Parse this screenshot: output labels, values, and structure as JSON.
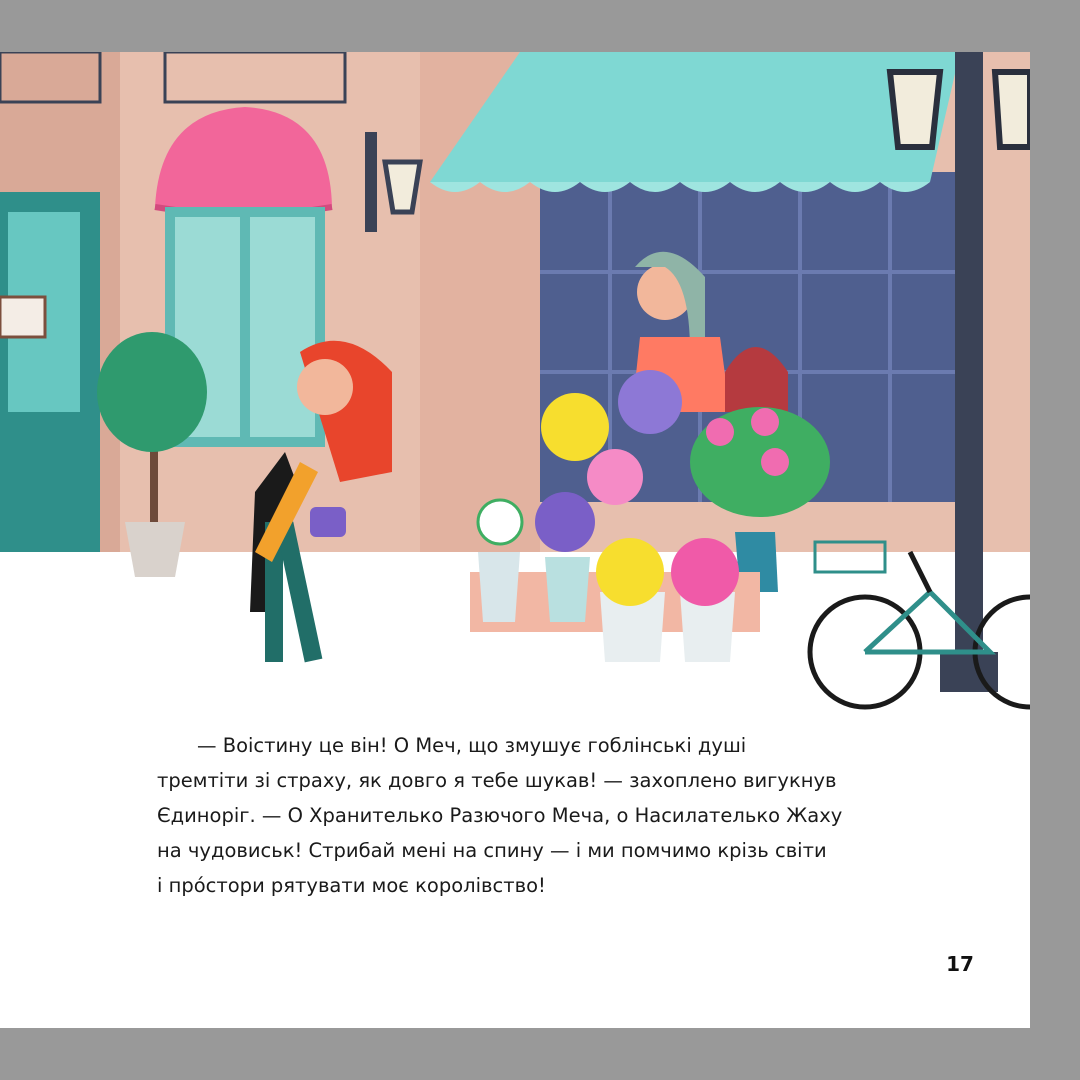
{
  "story": {
    "paragraph": "— Воістину це він! О Меч, що змушує гоблінські душі\nтремтіти зі страху, як довго я тебе шукав! — захоплено вигукнув\nЄдиноріг. — О Хранителько Разючого Меча, о Насилателько Жаху\nна чудовиськ! Стрибай мені на спину — і ми помчимо крізь світи\nі прóстори рятувати моє королівство!"
  },
  "page_number": "17",
  "colors": {
    "frame": "#999999",
    "page": "#ffffff",
    "awning_pink": "#f2669a",
    "awning_teal": "#7fd8d3",
    "building": "#e9b9a4",
    "shop_window": "#4f5f8f",
    "hair_red": "#e8452c",
    "lamp_post": "#3a4256"
  }
}
